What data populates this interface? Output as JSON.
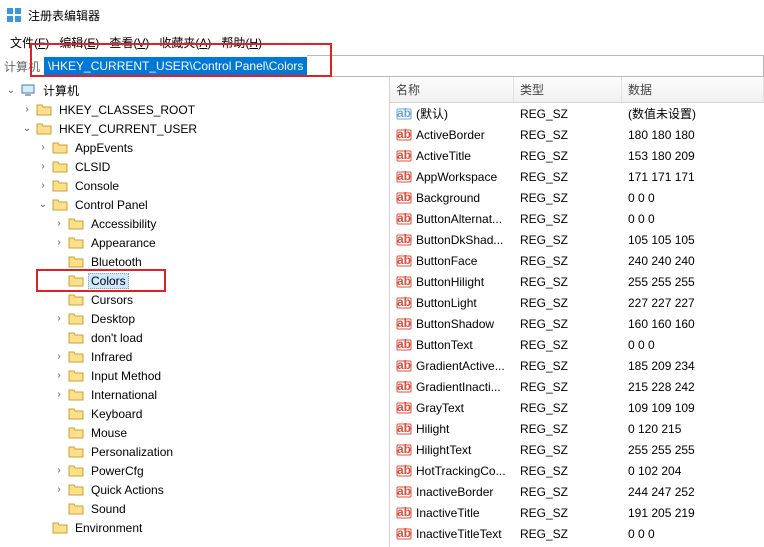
{
  "title": "注册表编辑器",
  "menu": [
    {
      "text": "文件(F)",
      "u": "F"
    },
    {
      "text": "编辑(E)",
      "u": "E"
    },
    {
      "text": "查看(V)",
      "u": "V"
    },
    {
      "text": "收藏夹(A)",
      "u": "A"
    },
    {
      "text": "帮助(H)",
      "u": "H"
    }
  ],
  "path_label": "计算机",
  "path_value": "\\HKEY_CURRENT_USER\\Control Panel\\Colors",
  "tree": {
    "root": {
      "label": "计算机",
      "expanded": true,
      "iconType": "computer",
      "children": [
        {
          "label": "HKEY_CLASSES_ROOT",
          "expanded": false,
          "hasChildren": true
        },
        {
          "label": "HKEY_CURRENT_USER",
          "expanded": true,
          "hasChildren": true,
          "children": [
            {
              "label": "AppEvents",
              "expanded": false,
              "hasChildren": true
            },
            {
              "label": "CLSID",
              "expanded": false,
              "hasChildren": true
            },
            {
              "label": "Console",
              "expanded": false,
              "hasChildren": true
            },
            {
              "label": "Control Panel",
              "expanded": true,
              "hasChildren": true,
              "children": [
                {
                  "label": "Accessibility",
                  "expanded": false,
                  "hasChildren": true
                },
                {
                  "label": "Appearance",
                  "expanded": false,
                  "hasChildren": true
                },
                {
                  "label": "Bluetooth",
                  "expanded": false,
                  "hasChildren": false
                },
                {
                  "label": "Colors",
                  "expanded": false,
                  "hasChildren": false,
                  "selected": true,
                  "highlight": true
                },
                {
                  "label": "Cursors",
                  "expanded": false,
                  "hasChildren": false
                },
                {
                  "label": "Desktop",
                  "expanded": false,
                  "hasChildren": true
                },
                {
                  "label": "don't load",
                  "expanded": false,
                  "hasChildren": false
                },
                {
                  "label": "Infrared",
                  "expanded": false,
                  "hasChildren": true
                },
                {
                  "label": "Input Method",
                  "expanded": false,
                  "hasChildren": true
                },
                {
                  "label": "International",
                  "expanded": false,
                  "hasChildren": true
                },
                {
                  "label": "Keyboard",
                  "expanded": false,
                  "hasChildren": false
                },
                {
                  "label": "Mouse",
                  "expanded": false,
                  "hasChildren": false
                },
                {
                  "label": "Personalization",
                  "expanded": false,
                  "hasChildren": false
                },
                {
                  "label": "PowerCfg",
                  "expanded": false,
                  "hasChildren": true
                },
                {
                  "label": "Quick Actions",
                  "expanded": false,
                  "hasChildren": true
                },
                {
                  "label": "Sound",
                  "expanded": false,
                  "hasChildren": false
                }
              ]
            },
            {
              "label": "Environment",
              "expanded": false,
              "hasChildren": false
            }
          ]
        }
      ]
    }
  },
  "list": {
    "headers": {
      "name": "名称",
      "type": "类型",
      "data": "数据"
    },
    "rows": [
      {
        "name": "(默认)",
        "type": "REG_SZ",
        "data": "(数值未设置)",
        "icon": "default"
      },
      {
        "name": "ActiveBorder",
        "type": "REG_SZ",
        "data": "180 180 180",
        "icon": "string"
      },
      {
        "name": "ActiveTitle",
        "type": "REG_SZ",
        "data": "153 180 209",
        "icon": "string"
      },
      {
        "name": "AppWorkspace",
        "type": "REG_SZ",
        "data": "171 171 171",
        "icon": "string"
      },
      {
        "name": "Background",
        "type": "REG_SZ",
        "data": "0 0 0",
        "icon": "string"
      },
      {
        "name": "ButtonAlternat...",
        "type": "REG_SZ",
        "data": "0 0 0",
        "icon": "string"
      },
      {
        "name": "ButtonDkShad...",
        "type": "REG_SZ",
        "data": "105 105 105",
        "icon": "string"
      },
      {
        "name": "ButtonFace",
        "type": "REG_SZ",
        "data": "240 240 240",
        "icon": "string"
      },
      {
        "name": "ButtonHilight",
        "type": "REG_SZ",
        "data": "255 255 255",
        "icon": "string"
      },
      {
        "name": "ButtonLight",
        "type": "REG_SZ",
        "data": "227 227 227",
        "icon": "string"
      },
      {
        "name": "ButtonShadow",
        "type": "REG_SZ",
        "data": "160 160 160",
        "icon": "string"
      },
      {
        "name": "ButtonText",
        "type": "REG_SZ",
        "data": "0 0 0",
        "icon": "string"
      },
      {
        "name": "GradientActive...",
        "type": "REG_SZ",
        "data": "185 209 234",
        "icon": "string"
      },
      {
        "name": "GradientInacti...",
        "type": "REG_SZ",
        "data": "215 228 242",
        "icon": "string"
      },
      {
        "name": "GrayText",
        "type": "REG_SZ",
        "data": "109 109 109",
        "icon": "string"
      },
      {
        "name": "Hilight",
        "type": "REG_SZ",
        "data": "0 120 215",
        "icon": "string"
      },
      {
        "name": "HilightText",
        "type": "REG_SZ",
        "data": "255 255 255",
        "icon": "string"
      },
      {
        "name": "HotTrackingCo...",
        "type": "REG_SZ",
        "data": "0 102 204",
        "icon": "string"
      },
      {
        "name": "InactiveBorder",
        "type": "REG_SZ",
        "data": "244 247 252",
        "icon": "string"
      },
      {
        "name": "InactiveTitle",
        "type": "REG_SZ",
        "data": "191 205 219",
        "icon": "string"
      },
      {
        "name": "InactiveTitleText",
        "type": "REG_SZ",
        "data": "0 0 0",
        "icon": "string"
      }
    ]
  }
}
